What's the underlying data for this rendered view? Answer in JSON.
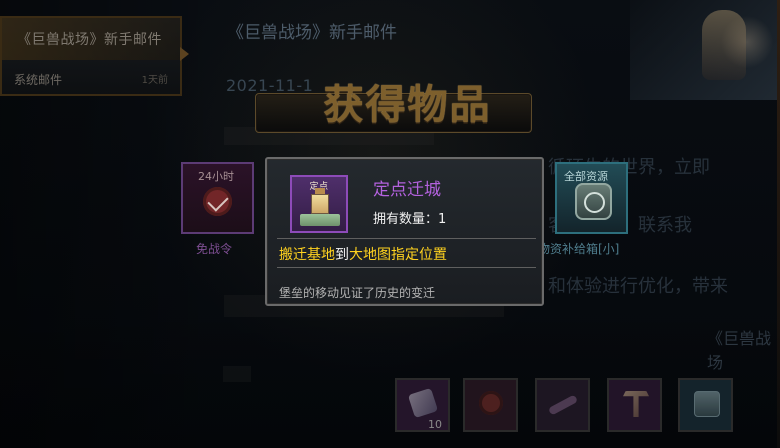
{
  "left_panel": {
    "selected_mail": "《巨兽战场》新手邮件",
    "second_mail": "系统邮件",
    "second_time": "1天前"
  },
  "mail": {
    "title": "《巨兽战场》新手邮件",
    "date": "2021-11-1",
    "line_right_1": "循环生的世界，立即",
    "line_right_2": "客服中心，联系我",
    "line_right_3": "和体验进行优化，带来",
    "line_right_4": "《巨兽战场"
  },
  "header": {
    "title": "获得物品"
  },
  "left_card": {
    "badge": "24小时",
    "label": "免战令"
  },
  "right_card": {
    "badge": "全部资源",
    "label": "物资补给箱[小]"
  },
  "tooltip": {
    "icon_label": "定点",
    "name": "定点迁城",
    "owned": "拥有数量：1",
    "desc_parts": [
      {
        "text": "搬迁基地",
        "color": "#ffd21f"
      },
      {
        "text": "到",
        "color": "#f1f1f1"
      },
      {
        "text": "大地图指定位置",
        "color": "#ffd21f"
      }
    ],
    "flavor": "堡垒的移动见证了历史的变迁"
  },
  "bottom_rewards": {
    "count_1": "10"
  },
  "colors": {
    "accent_gold": "#ffd21f",
    "rare_purple": "#b462df",
    "card_border": "#8d4bb9"
  },
  "icons": {
    "tooltip_item": "relocation-icon",
    "left_item": "shield-icon",
    "right_item": "supply-box-icon"
  }
}
